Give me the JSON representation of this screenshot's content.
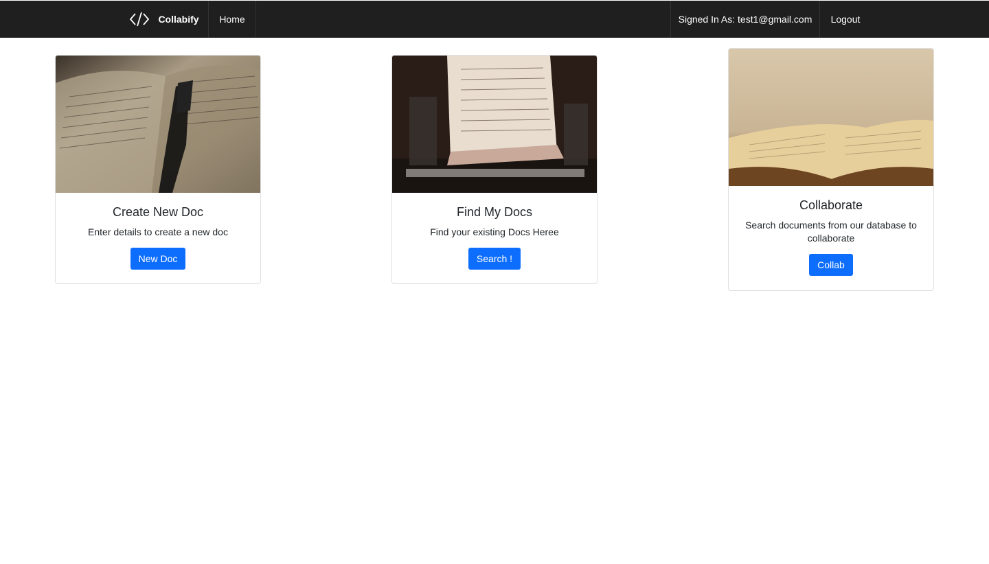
{
  "navbar": {
    "brand_label": "Collabify",
    "logo_icon": "code-brackets-icon",
    "home_label": "Home",
    "signed_in_label": "Signed In As: test1@gmail.com",
    "logout_label": "Logout",
    "background": "#1f1f1f"
  },
  "cards": [
    {
      "title": "Create New Doc",
      "text": "Enter details to create a new doc",
      "button_label": "New Doc",
      "image_icon": "open-book-with-pen-photo"
    },
    {
      "title": "Find My Docs",
      "text": "Find your existing Docs Heree",
      "button_label": "Search !",
      "image_icon": "typewriter-paper-photo"
    },
    {
      "title": "Collaborate",
      "text": "Search documents from our database to collaborate",
      "button_label": "Collab",
      "image_icon": "open-book-photo"
    }
  ],
  "colors": {
    "button": "#0d6efd",
    "card_border": "#dfdfdf"
  }
}
